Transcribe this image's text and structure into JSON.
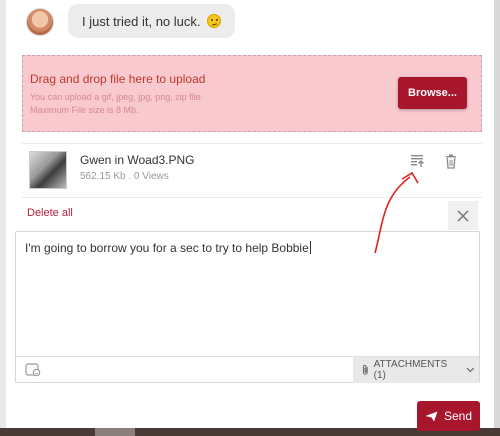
{
  "chat": {
    "last_message": "I just tried it, no luck."
  },
  "dropzone": {
    "title": "Drag and drop file here to upload",
    "allowed_types": "You can upload a gif, jpeg, jpg, png, zip file.",
    "max_size": "Maximum File size is 8 Mb.",
    "browse_label": "Browse..."
  },
  "attachment": {
    "file_name": "Gwen in Woad3.PNG",
    "meta": "562.15 Kb . 0 Views"
  },
  "actions": {
    "delete_all": "Delete all"
  },
  "composer": {
    "text": "I'm going to borrow you for a sec to try to help Bobbie",
    "attachments_label": "ATTACHMENTS (1)",
    "send_label": "Send"
  },
  "colors": {
    "accent": "#a8162e",
    "dropzone_bg": "#f8c9cf",
    "annotation": "#e02020"
  },
  "icons": {
    "emoji": "confused-face-icon",
    "upload": "upload-icon",
    "trash": "trash-icon",
    "close": "close-icon",
    "attach": "paperclip-icon",
    "chevron": "chevron-down-icon",
    "send": "send-icon",
    "emoji_picker": "emoji-picker-icon"
  }
}
